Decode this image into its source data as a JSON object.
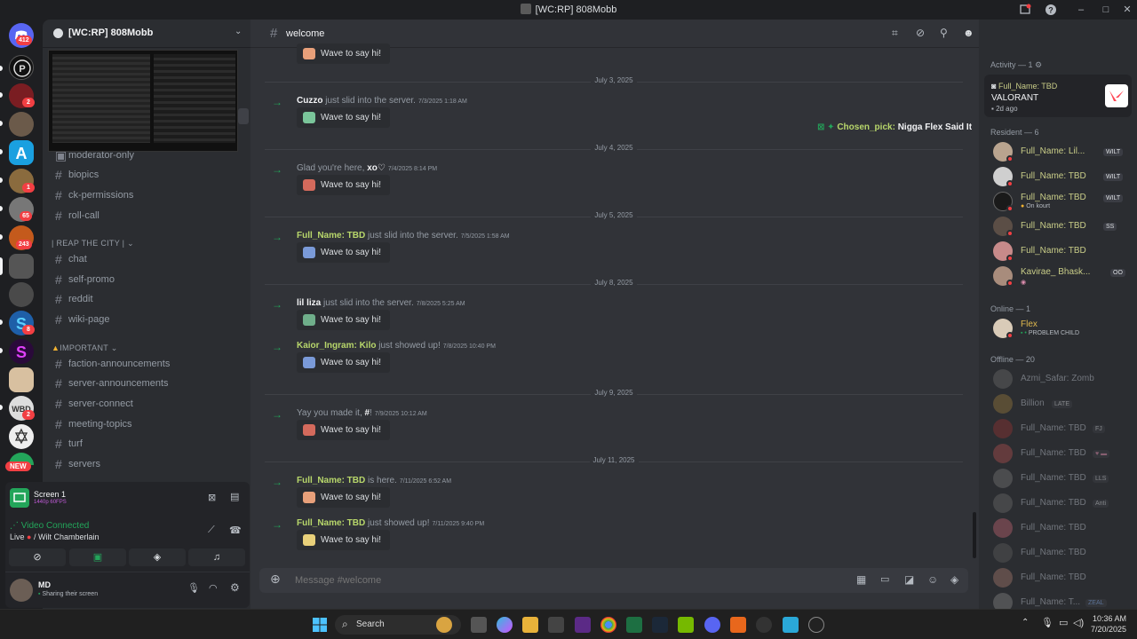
{
  "window": {
    "title": "[WC:RP] 808Mobb"
  },
  "rail": {
    "home_badge": "412",
    "badges": [
      "2",
      "1",
      "65",
      "243",
      "8",
      "2"
    ],
    "new_label": "NEW"
  },
  "server": {
    "name": "[WC:RP] 808Mobb"
  },
  "sidebar": {
    "channels_top": [
      "moderator-only",
      "biopics",
      "ck-permissions",
      "roll-call"
    ],
    "category_city": "| REAP THE CITY |",
    "channels_city": [
      "chat",
      "self-promo",
      "reddit",
      "wiki-page"
    ],
    "category_important": "IMPORTANT",
    "channels_important": [
      "faction-announcements",
      "server-announcements",
      "server-connect",
      "meeting-topics",
      "turf",
      "servers"
    ]
  },
  "voice": {
    "stream_title": "Screen 1",
    "stream_quality": "1440p 60FPS",
    "status": "Video Connected",
    "live_label": "Live",
    "live_channel": "/ Wilt Chamberlain"
  },
  "user": {
    "name": "MD",
    "status": "Sharing their screen"
  },
  "chat": {
    "channel": "welcome",
    "wave_label": "Wave to say hi!",
    "composer_placeholder": "Message #welcome",
    "dates": [
      "July 3, 2025",
      "July 4, 2025",
      "July 5, 2025",
      "July 8, 2025",
      "July 9, 2025",
      "July 11, 2025"
    ],
    "messages": [
      {
        "user": "Cuzzo",
        "text": "just slid into the server.",
        "ts": "7/3/2025 1:18 AM"
      },
      {
        "user": "",
        "prefix": "Glad you're here, ",
        "user_inline": "xo♡",
        "text": "",
        "ts": "7/4/2025 8:14 PM"
      },
      {
        "user": "Full_Name: TBD",
        "text": "just slid into the server.",
        "ts": "7/5/2025 1:58 AM"
      },
      {
        "user": "lil liza",
        "text": "just slid into the server.",
        "ts": "7/8/2025 5:25 AM"
      },
      {
        "user": "Kaior_Ingram: Kilo",
        "text": "just showed up!",
        "ts": "7/8/2025 10:40 PM"
      },
      {
        "user": "",
        "prefix": "Yay you made it, ",
        "user_inline": "#",
        "text": "!",
        "ts": "7/9/2025 10:12 AM"
      },
      {
        "user": "Full_Name: TBD",
        "text": "is here.",
        "ts": "7/11/2025 6:52 AM"
      },
      {
        "user": "Full_Name: TBD",
        "text": "just showed up!",
        "ts": "7/11/2025 9:40 PM"
      }
    ],
    "floating_activity": {
      "user": "Chosen_pick:",
      "text": "Nigga Flex Said It"
    }
  },
  "search": {
    "placeholder": "Search"
  },
  "members": {
    "activity_header": "Activity — 1",
    "activity": {
      "name": "Full_Name: TBD",
      "game": "VALORANT",
      "time": "2d ago"
    },
    "resident_header": "Resident — 6",
    "resident": [
      {
        "name": "Full_Name: Lil...",
        "tag": "WILT"
      },
      {
        "name": "Full_Name: TBD",
        "tag": "WILT"
      },
      {
        "name": "Full_Name: TBD",
        "tag": "WILT",
        "sub": "On kourt"
      },
      {
        "name": "Full_Name: TBD",
        "tag": "SS"
      },
      {
        "name": "Full_Name: TBD",
        "tag": ""
      },
      {
        "name": "Kavirae_ Bhask...",
        "tag": "OO"
      }
    ],
    "online_header": "Online — 1",
    "online": [
      {
        "name": "Flex",
        "sub": "PROBLEM CHILD"
      }
    ],
    "offline_header": "Offline — 20",
    "offline": [
      {
        "name": "Azmi_Safar: Zomb",
        "tag": ""
      },
      {
        "name": "Billion",
        "tag": "LATE"
      },
      {
        "name": "Full_Name: TBD",
        "tag": "FJ"
      },
      {
        "name": "Full_Name: TBD",
        "tag": ""
      },
      {
        "name": "Full_Name: TBD",
        "tag": "LLS"
      },
      {
        "name": "Full_Name: TBD",
        "tag": "Anti"
      },
      {
        "name": "Full_Name: TBD",
        "tag": ""
      },
      {
        "name": "Full_Name: TBD",
        "tag": ""
      },
      {
        "name": "Full_Name: TBD",
        "tag": ""
      },
      {
        "name": "Full_Name: T...",
        "tag": "ZEAL"
      }
    ]
  },
  "taskbar": {
    "search_label": "Search",
    "time": "10:36 AM",
    "date": "7/20/2025"
  },
  "colors": {
    "accent": "#5865f2",
    "online": "#23a55a",
    "dnd": "#f23f43",
    "member_name": "#c9cd88"
  }
}
